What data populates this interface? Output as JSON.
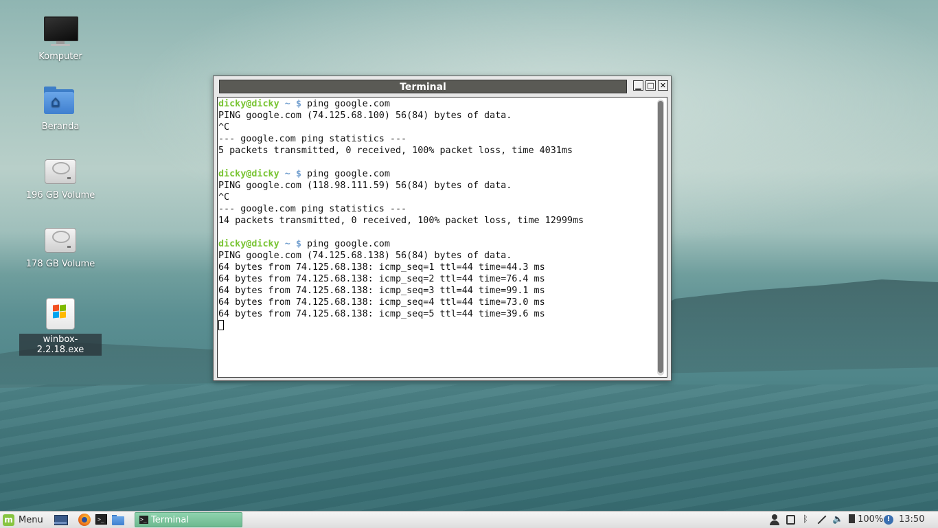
{
  "desktop": {
    "icons": [
      {
        "label": "Komputer"
      },
      {
        "label": "Beranda"
      },
      {
        "label": "196 GB Volume"
      },
      {
        "label": "178 GB Volume"
      },
      {
        "label": "winbox-2.2.18.exe"
      }
    ]
  },
  "window": {
    "title": "Terminal",
    "buttons": {
      "minimize": "▁",
      "maximize": "□",
      "close": "✕"
    }
  },
  "terminal": {
    "prompt_user": "dicky@dicky",
    "prompt_tilde": "~ $",
    "blocks": [
      {
        "command": " ping google.com",
        "output": "PING google.com (74.125.68.100) 56(84) bytes of data.\n^C\n--- google.com ping statistics ---\n5 packets transmitted, 0 received, 100% packet loss, time 4031ms\n"
      },
      {
        "command": " ping google.com",
        "output": "PING google.com (118.98.111.59) 56(84) bytes of data.\n^C\n--- google.com ping statistics ---\n14 packets transmitted, 0 received, 100% packet loss, time 12999ms\n"
      },
      {
        "command": " ping google.com",
        "output": "PING google.com (74.125.68.138) 56(84) bytes of data.\n64 bytes from 74.125.68.138: icmp_seq=1 ttl=44 time=44.3 ms\n64 bytes from 74.125.68.138: icmp_seq=2 ttl=44 time=76.4 ms\n64 bytes from 74.125.68.138: icmp_seq=3 ttl=44 time=99.1 ms\n64 bytes from 74.125.68.138: icmp_seq=4 ttl=44 time=73.0 ms\n64 bytes from 74.125.68.138: icmp_seq=5 ttl=44 time=39.6 ms"
      }
    ]
  },
  "taskbar": {
    "menu_label": "Menu",
    "launchers": [
      "show-desktop-icon",
      "firefox-icon",
      "terminal-icon",
      "files-icon"
    ],
    "active_task": "Terminal",
    "tray": {
      "battery": "100%",
      "clock": "13:50"
    },
    "colors": {
      "accent": "#7fc5a0",
      "mint": "#87c440"
    }
  }
}
